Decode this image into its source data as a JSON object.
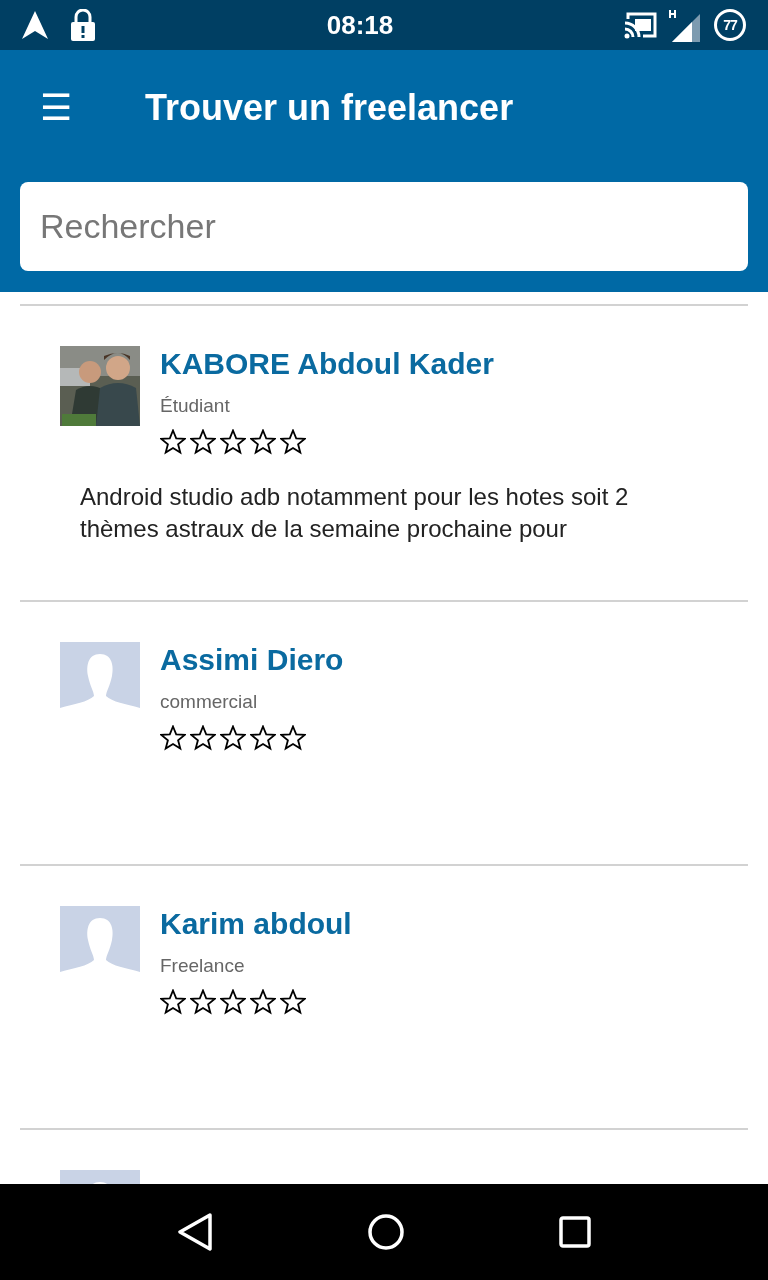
{
  "status_bar": {
    "time": "08:18",
    "battery": "77"
  },
  "app_bar": {
    "menu_icon": "☰",
    "title": "Trouver un freelancer"
  },
  "search": {
    "placeholder": "Rechercher"
  },
  "freelancers": [
    {
      "name": "KABORE Abdoul Kader",
      "role": "Étudiant",
      "stars": 0,
      "description": "Android studio adb notamment pour les hotes soit 2 thèmes astraux de la semaine prochaine pour"
    },
    {
      "name": "Assimi Diero",
      "role": "commercial",
      "stars": 0,
      "kind": "placeholder"
    },
    {
      "name": "Karim abdoul",
      "role": "Freelance",
      "stars": 0,
      "kind": "placeholder"
    },
    {
      "kind": "placeholder"
    }
  ]
}
